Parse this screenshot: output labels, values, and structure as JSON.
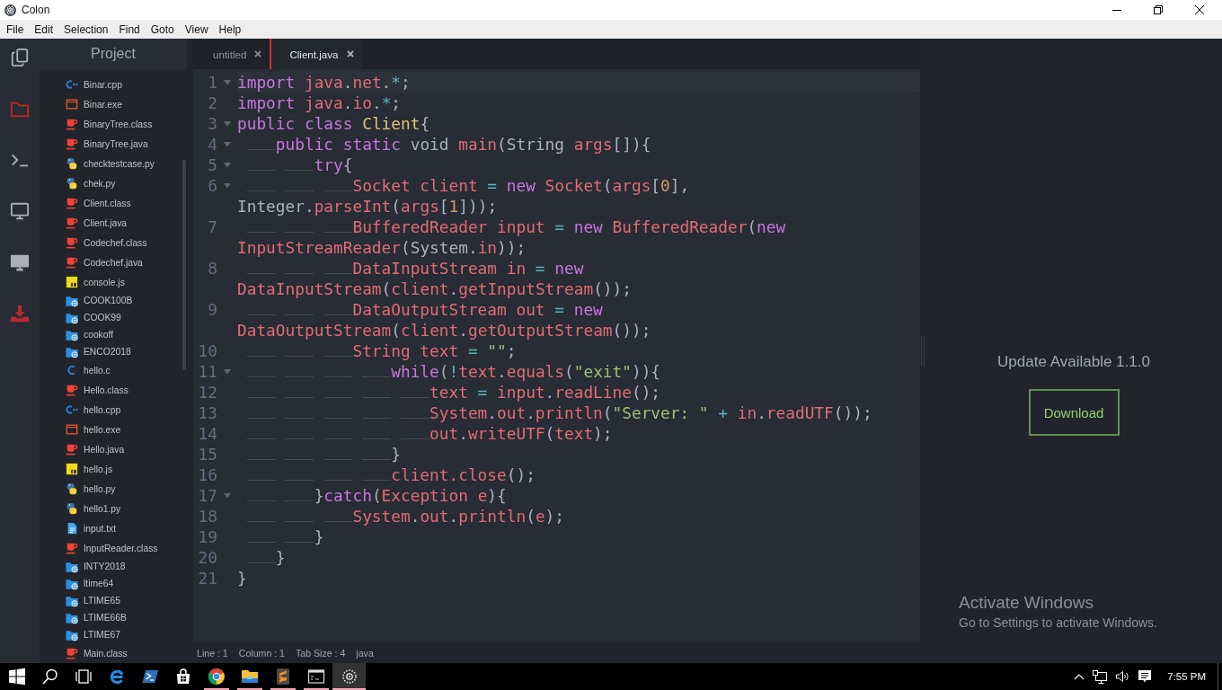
{
  "window": {
    "title": "Colon"
  },
  "menu": [
    "File",
    "Edit",
    "Selection",
    "Find",
    "Goto",
    "View",
    "Help"
  ],
  "activity_bar": [
    {
      "kind": "files",
      "highlighted": false
    },
    {
      "kind": "folder",
      "highlighted": true
    },
    {
      "kind": "terminal",
      "highlighted": false
    },
    {
      "kind": "monitor",
      "highlighted": false
    },
    {
      "kind": "display",
      "highlighted": false
    },
    {
      "kind": "download",
      "highlighted": true
    }
  ],
  "sidebar": {
    "title": "Project",
    "files": [
      {
        "name": "Binar.cpp",
        "kind": "cpp"
      },
      {
        "name": "Binar.exe",
        "kind": "exe"
      },
      {
        "name": "BinaryTree.class",
        "kind": "java"
      },
      {
        "name": "BinaryTree.java",
        "kind": "java"
      },
      {
        "name": "checktestcase.py",
        "kind": "python"
      },
      {
        "name": "chek.py",
        "kind": "python"
      },
      {
        "name": "Client.class",
        "kind": "java"
      },
      {
        "name": "Client.java",
        "kind": "java"
      },
      {
        "name": "Codechef.class",
        "kind": "java"
      },
      {
        "name": "Codechef.java",
        "kind": "java"
      },
      {
        "name": "console.js",
        "kind": "js"
      },
      {
        "name": "COOK100B",
        "kind": "folder"
      },
      {
        "name": "COOK99",
        "kind": "folder"
      },
      {
        "name": "cookoff",
        "kind": "folder"
      },
      {
        "name": "ENCO2018",
        "kind": "folder"
      },
      {
        "name": "hello.c",
        "kind": "c"
      },
      {
        "name": "Hello.class",
        "kind": "java"
      },
      {
        "name": "hello.cpp",
        "kind": "cpp"
      },
      {
        "name": "hello.exe",
        "kind": "exe"
      },
      {
        "name": "Hello.java",
        "kind": "java"
      },
      {
        "name": "hello.js",
        "kind": "js"
      },
      {
        "name": "hello.py",
        "kind": "python"
      },
      {
        "name": "hello1.py",
        "kind": "python"
      },
      {
        "name": "input.txt",
        "kind": "text"
      },
      {
        "name": "InputReader.class",
        "kind": "java"
      },
      {
        "name": "INTY2018",
        "kind": "folder"
      },
      {
        "name": "ltime64",
        "kind": "folder"
      },
      {
        "name": "LTIME65",
        "kind": "folder"
      },
      {
        "name": "LTIME66B",
        "kind": "folder"
      },
      {
        "name": "LTIME67",
        "kind": "folder"
      },
      {
        "name": "Main.class",
        "kind": "java"
      }
    ]
  },
  "editor": {
    "tabs": [
      {
        "label": "untitled",
        "selected": false
      },
      {
        "label": "Client.java",
        "selected": true
      }
    ],
    "lines": [
      {
        "number": "1",
        "fold": true,
        "current": true,
        "tokens": [
          {
            "kind": "keyword",
            "text": "import "
          },
          {
            "kind": "identifier",
            "text": "java"
          },
          {
            "kind": "plain",
            "text": "."
          },
          {
            "kind": "identifier",
            "text": "net"
          },
          {
            "kind": "plain",
            "text": "."
          },
          {
            "kind": "operator",
            "text": "*"
          },
          {
            "kind": "plain",
            "text": ";"
          }
        ]
      },
      {
        "number": "2",
        "fold": false,
        "current": false,
        "tokens": [
          {
            "kind": "keyword",
            "text": "import "
          },
          {
            "kind": "identifier",
            "text": "java"
          },
          {
            "kind": "plain",
            "text": "."
          },
          {
            "kind": "identifier",
            "text": "io"
          },
          {
            "kind": "plain",
            "text": "."
          },
          {
            "kind": "operator",
            "text": "*"
          },
          {
            "kind": "plain",
            "text": ";"
          }
        ]
      },
      {
        "number": "3",
        "fold": true,
        "current": false,
        "tokens": [
          {
            "kind": "keyword",
            "text": "public class "
          },
          {
            "kind": "type",
            "text": "Client"
          },
          {
            "kind": "plain",
            "text": "{"
          }
        ]
      },
      {
        "number": "4",
        "fold": true,
        "current": false,
        "tokens": [
          {
            "kind": "keyword",
            "text": "\tpublic static "
          },
          {
            "kind": "plain",
            "text": "void "
          },
          {
            "kind": "identifier",
            "text": "main"
          },
          {
            "kind": "plain",
            "text": "(String "
          },
          {
            "kind": "identifier",
            "text": "args"
          },
          {
            "kind": "plain",
            "text": "[]){"
          }
        ]
      },
      {
        "number": "5",
        "fold": true,
        "current": false,
        "tokens": [
          {
            "kind": "keyword",
            "text": "\t\ttry"
          },
          {
            "kind": "plain",
            "text": "{"
          }
        ]
      },
      {
        "number": "6",
        "fold": true,
        "current": false,
        "tokens": [
          {
            "kind": "identifier",
            "text": "\t\t\tSocket client "
          },
          {
            "kind": "operator",
            "text": "= "
          },
          {
            "kind": "keyword",
            "text": "new"
          },
          {
            "kind": "identifier",
            "text": " Socket"
          },
          {
            "kind": "plain",
            "text": "("
          },
          {
            "kind": "identifier",
            "text": "args"
          },
          {
            "kind": "plain",
            "text": "["
          },
          {
            "kind": "number",
            "text": "0"
          },
          {
            "kind": "plain",
            "text": "], Integer."
          },
          {
            "kind": "identifier",
            "text": "parseInt"
          },
          {
            "kind": "plain",
            "text": "("
          },
          {
            "kind": "identifier",
            "text": "args"
          },
          {
            "kind": "plain",
            "text": "["
          },
          {
            "kind": "number",
            "text": "1"
          },
          {
            "kind": "plain",
            "text": "]));"
          }
        ]
      },
      {
        "number": "7",
        "fold": false,
        "current": false,
        "tokens": [
          {
            "kind": "identifier",
            "text": "\t\t\tBufferedReader input "
          },
          {
            "kind": "operator",
            "text": "= "
          },
          {
            "kind": "keyword",
            "text": "new"
          },
          {
            "kind": "identifier",
            "text": " BufferedReader"
          },
          {
            "kind": "plain",
            "text": "("
          },
          {
            "kind": "keyword",
            "text": "new"
          },
          {
            "kind": "identifier",
            "text": " InputStreamReader"
          },
          {
            "kind": "plain",
            "text": "(System."
          },
          {
            "kind": "identifier",
            "text": "in"
          },
          {
            "kind": "plain",
            "text": "));"
          }
        ]
      },
      {
        "number": "8",
        "fold": false,
        "current": false,
        "tokens": [
          {
            "kind": "identifier",
            "text": "\t\t\tDataInputStream in "
          },
          {
            "kind": "operator",
            "text": "= "
          },
          {
            "kind": "keyword",
            "text": "new"
          },
          {
            "kind": "identifier",
            "text": " DataInputStream"
          },
          {
            "kind": "plain",
            "text": "("
          },
          {
            "kind": "identifier",
            "text": "client"
          },
          {
            "kind": "plain",
            "text": "."
          },
          {
            "kind": "identifier",
            "text": "getInputStream"
          },
          {
            "kind": "plain",
            "text": "());"
          }
        ]
      },
      {
        "number": "9",
        "fold": false,
        "current": false,
        "tokens": [
          {
            "kind": "identifier",
            "text": "\t\t\tDataOutputStream out "
          },
          {
            "kind": "operator",
            "text": "= "
          },
          {
            "kind": "keyword",
            "text": "new"
          },
          {
            "kind": "identifier",
            "text": " DataOutputStream"
          },
          {
            "kind": "plain",
            "text": "("
          },
          {
            "kind": "identifier",
            "text": "client"
          },
          {
            "kind": "plain",
            "text": "."
          },
          {
            "kind": "identifier",
            "text": "getOutputStream"
          },
          {
            "kind": "plain",
            "text": "());"
          }
        ]
      },
      {
        "number": "10",
        "fold": false,
        "current": false,
        "tokens": [
          {
            "kind": "identifier",
            "text": "\t\t\tString text "
          },
          {
            "kind": "operator",
            "text": "= "
          },
          {
            "kind": "string",
            "text": "\"\""
          },
          {
            "kind": "plain",
            "text": ";"
          }
        ]
      },
      {
        "number": "11",
        "fold": true,
        "current": false,
        "tokens": [
          {
            "kind": "keyword",
            "text": "\t\t\t\twhile"
          },
          {
            "kind": "plain",
            "text": "("
          },
          {
            "kind": "operator",
            "text": "!"
          },
          {
            "kind": "identifier",
            "text": "text"
          },
          {
            "kind": "plain",
            "text": "."
          },
          {
            "kind": "identifier",
            "text": "equals"
          },
          {
            "kind": "plain",
            "text": "("
          },
          {
            "kind": "string",
            "text": "\"exit\""
          },
          {
            "kind": "plain",
            "text": ")){"
          }
        ]
      },
      {
        "number": "12",
        "fold": false,
        "current": false,
        "tokens": [
          {
            "kind": "identifier",
            "text": "\t\t\t\t\ttext "
          },
          {
            "kind": "operator",
            "text": "= "
          },
          {
            "kind": "identifier",
            "text": "input"
          },
          {
            "kind": "plain",
            "text": "."
          },
          {
            "kind": "identifier",
            "text": "readLine"
          },
          {
            "kind": "plain",
            "text": "();"
          }
        ]
      },
      {
        "number": "13",
        "fold": false,
        "current": false,
        "tokens": [
          {
            "kind": "identifier",
            "text": "\t\t\t\t\tSystem"
          },
          {
            "kind": "plain",
            "text": "."
          },
          {
            "kind": "identifier",
            "text": "out"
          },
          {
            "kind": "plain",
            "text": "."
          },
          {
            "kind": "identifier",
            "text": "println"
          },
          {
            "kind": "plain",
            "text": "("
          },
          {
            "kind": "string",
            "text": "\"Server: \""
          },
          {
            "kind": "operator",
            "text": " + "
          },
          {
            "kind": "identifier",
            "text": "in"
          },
          {
            "kind": "plain",
            "text": "."
          },
          {
            "kind": "identifier",
            "text": "readUTF"
          },
          {
            "kind": "plain",
            "text": "());"
          }
        ]
      },
      {
        "number": "14",
        "fold": false,
        "current": false,
        "tokens": [
          {
            "kind": "identifier",
            "text": "\t\t\t\t\tout"
          },
          {
            "kind": "plain",
            "text": "."
          },
          {
            "kind": "identifier",
            "text": "writeUTF"
          },
          {
            "kind": "plain",
            "text": "("
          },
          {
            "kind": "identifier",
            "text": "text"
          },
          {
            "kind": "plain",
            "text": ");"
          }
        ]
      },
      {
        "number": "15",
        "fold": false,
        "current": false,
        "tokens": [
          {
            "kind": "plain",
            "text": "\t\t\t\t}"
          }
        ]
      },
      {
        "number": "16",
        "fold": false,
        "current": false,
        "tokens": [
          {
            "kind": "identifier",
            "text": "\t\t\t\tclient.close"
          },
          {
            "kind": "plain",
            "text": "();"
          }
        ]
      },
      {
        "number": "17",
        "fold": true,
        "current": false,
        "tokens": [
          {
            "kind": "plain",
            "text": "\t\t}"
          },
          {
            "kind": "keyword",
            "text": "catch"
          },
          {
            "kind": "plain",
            "text": "("
          },
          {
            "kind": "identifier",
            "text": "Exception e"
          },
          {
            "kind": "plain",
            "text": "){"
          }
        ]
      },
      {
        "number": "18",
        "fold": false,
        "current": false,
        "tokens": [
          {
            "kind": "identifier",
            "text": "\t\t\tSystem"
          },
          {
            "kind": "plain",
            "text": "."
          },
          {
            "kind": "identifier",
            "text": "out"
          },
          {
            "kind": "plain",
            "text": "."
          },
          {
            "kind": "identifier",
            "text": "println"
          },
          {
            "kind": "plain",
            "text": "("
          },
          {
            "kind": "identifier",
            "text": "e"
          },
          {
            "kind": "plain",
            "text": ");"
          }
        ]
      },
      {
        "number": "19",
        "fold": false,
        "current": false,
        "tokens": [
          {
            "kind": "plain",
            "text": "\t\t}"
          }
        ]
      },
      {
        "number": "20",
        "fold": false,
        "current": false,
        "tokens": [
          {
            "kind": "plain",
            "text": "\t}"
          }
        ]
      },
      {
        "number": "21",
        "fold": false,
        "current": false,
        "tokens": [
          {
            "kind": "plain",
            "text": "}"
          }
        ]
      }
    ]
  },
  "status_bar": [
    "Line : 1",
    "Column : 1",
    "Tab Size : 4",
    "java"
  ],
  "update_panel": {
    "message": "Update Available 1.1.0",
    "button": "Download"
  },
  "watermark": {
    "title": "Activate Windows",
    "text": "Go to Settings to activate Windows."
  },
  "taskbar": {
    "apps": [
      {
        "kind": "start",
        "running": false,
        "active": false
      },
      {
        "kind": "search",
        "running": false,
        "active": false
      },
      {
        "kind": "taskview",
        "running": false,
        "active": false
      },
      {
        "kind": "edge",
        "running": false,
        "active": false
      },
      {
        "kind": "remote",
        "running": false,
        "active": false
      },
      {
        "kind": "store",
        "running": false,
        "active": false
      },
      {
        "kind": "chrome",
        "running": true,
        "active": false
      },
      {
        "kind": "explorer",
        "running": true,
        "active": false
      },
      {
        "kind": "sublime",
        "running": true,
        "active": false
      },
      {
        "kind": "console",
        "running": true,
        "active": false
      },
      {
        "kind": "colon",
        "running": true,
        "active": true
      }
    ],
    "clock": "7:55 PM"
  }
}
